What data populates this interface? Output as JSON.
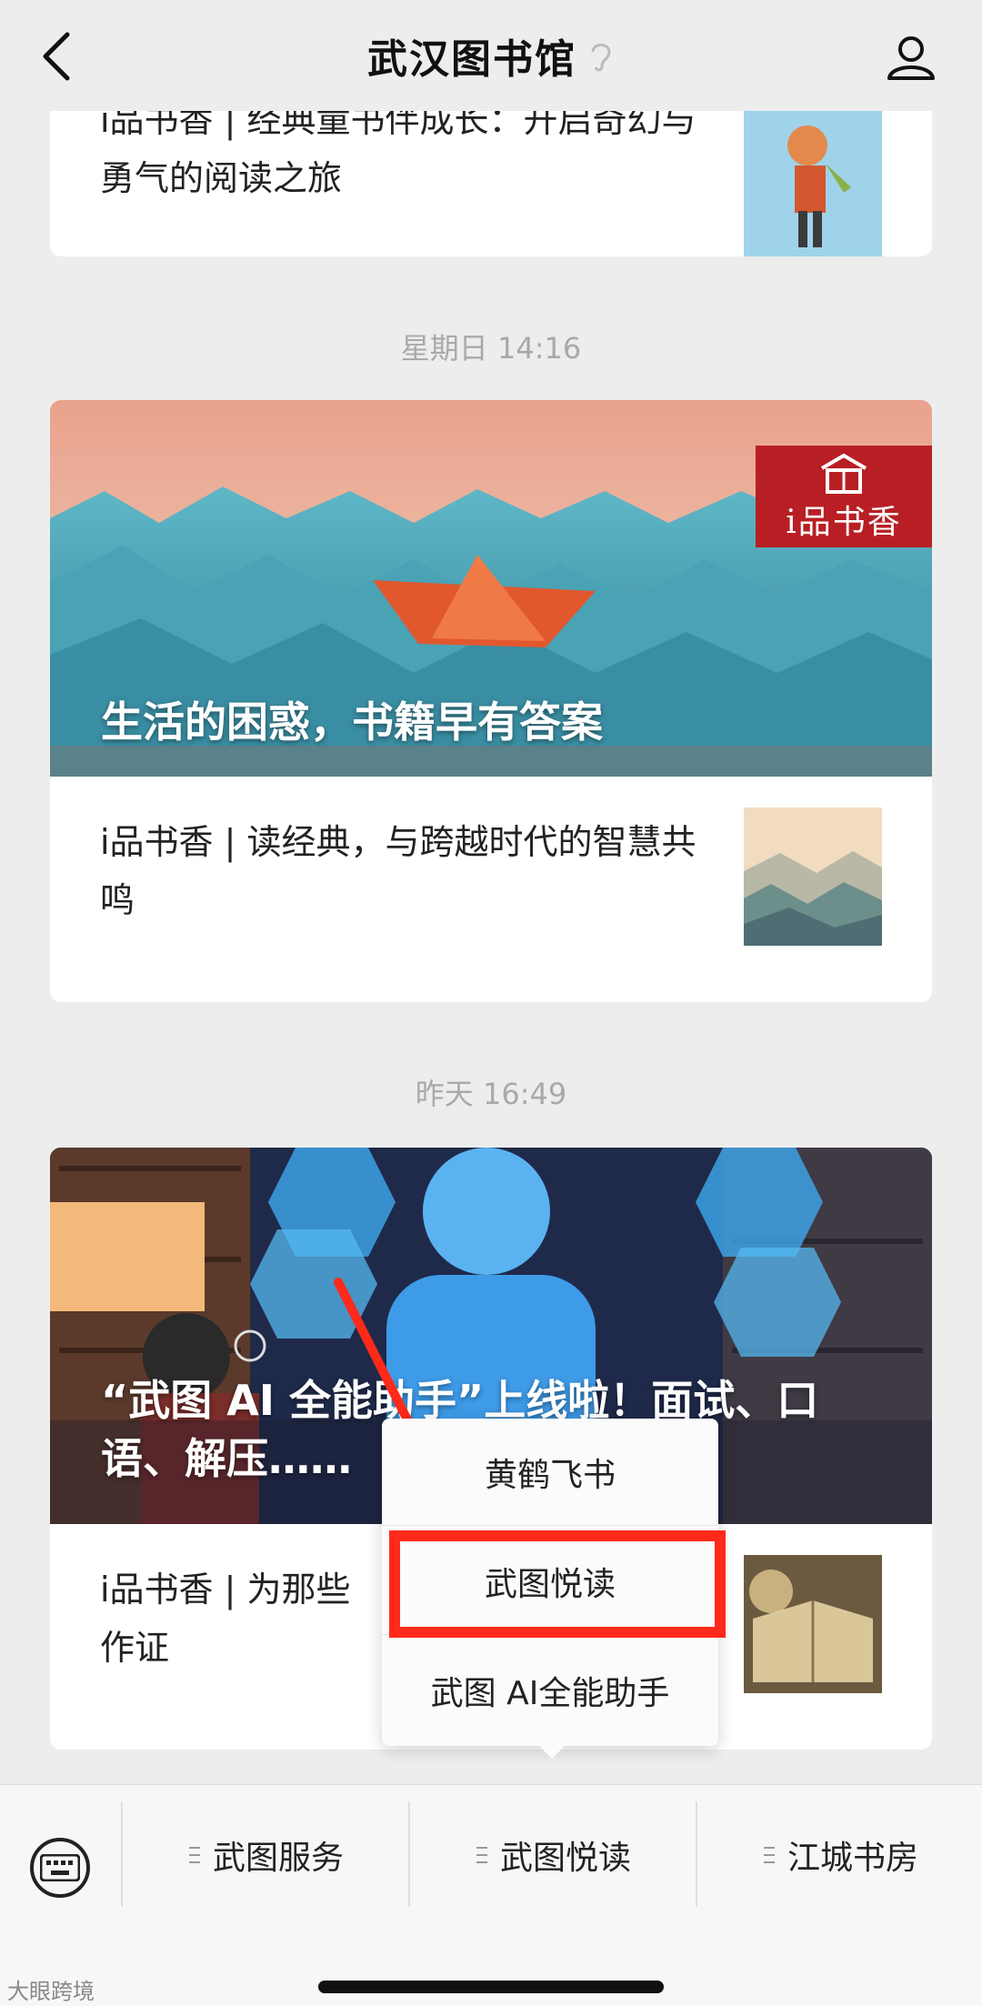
{
  "navbar": {
    "title": "武汉图书馆",
    "back_icon": "chevron-left-icon",
    "user_icon": "user-icon",
    "ear_icon": "ear-icon"
  },
  "card0": {
    "title": "i品书香 | 经典童书伴成长：开启奇幻与勇气的阅读之旅"
  },
  "group1": {
    "timestamp": "星期日 14:16",
    "hero_caption": "生活的困惑，书籍早有答案",
    "badge_text": "i品书香",
    "article_title": "i品书香 | 读经典，与跨越时代的智慧共鸣"
  },
  "group2": {
    "timestamp": "昨天 16:49",
    "hero_caption": "“武图 AI 全能助手”上线啦！面试、口语、解压……",
    "hero_caption_end": "！",
    "article_title": "i品书香 | 为那些",
    "article_title_line2": "作证"
  },
  "submenu": {
    "items": [
      "黄鹤飞书",
      "武图悦读",
      "武图 AI全能助手"
    ],
    "highlighted_index": 1,
    "highlight_color": "#ff2a1a"
  },
  "bottom_menu": {
    "keyboard_icon": "keyboard-icon",
    "items": [
      "武图服务",
      "武图悦读",
      "江城书房"
    ]
  },
  "watermark": "大眼跨境"
}
